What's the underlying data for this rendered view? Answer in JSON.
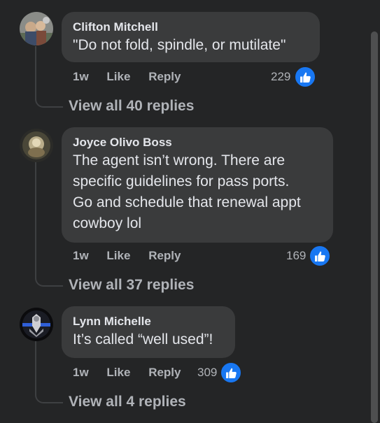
{
  "comments": [
    {
      "author": "Clifton Mitchell",
      "text": "\"Do not fold, spindle, or mutilate\"",
      "time": "1w",
      "like_label": "Like",
      "reply_label": "Reply",
      "reaction_count": "229",
      "view_replies": "View all 40 replies"
    },
    {
      "author": "Joyce Olivo Boss",
      "text": "The agent isn’t wrong. There are\nspecific guidelines for pass ports.\nGo and schedule that renewal appt\ncowboy lol",
      "time": "1w",
      "like_label": "Like",
      "reply_label": "Reply",
      "reaction_count": "169",
      "view_replies": "View all 37 replies"
    },
    {
      "author": "Lynn Michelle",
      "text": "It’s called “well used”!",
      "time": "1w",
      "like_label": "Like",
      "reply_label": "Reply",
      "reaction_count": "309",
      "view_replies": "View all 4 replies"
    }
  ],
  "icons": {
    "reaction": "thumbs-up-icon"
  },
  "colors": {
    "background": "#242526",
    "bubble": "#3a3b3c",
    "like_blue": "#1877f2",
    "muted_text": "#b0b3b8"
  }
}
